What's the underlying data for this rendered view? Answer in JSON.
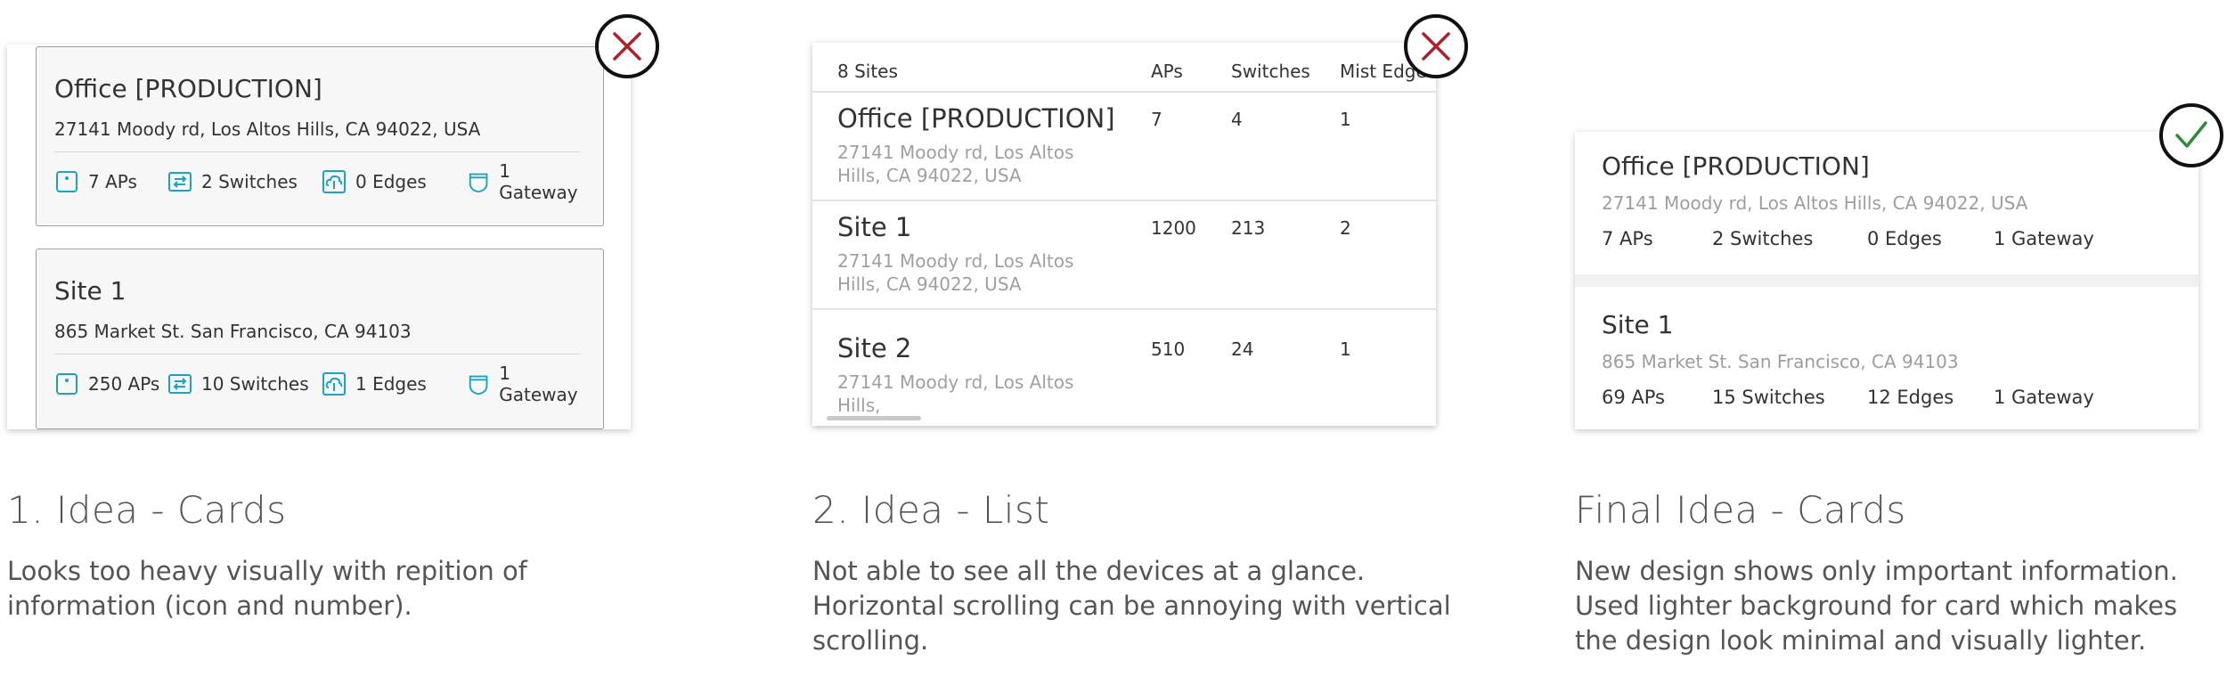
{
  "idea1": {
    "cards": [
      {
        "title": "Office [PRODUCTION]",
        "address": "27141 Moody rd, Los Altos Hills, CA 94022, USA",
        "aps": "7 APs",
        "switches": "2 Switches",
        "edges": "0 Edges",
        "gateways": "1 Gateway"
      },
      {
        "title": "Site 1",
        "address": "865 Market St. San Francisco, CA 94103",
        "aps": "250 APs",
        "switches": "10 Switches",
        "edges": "1 Edges",
        "gateways": "1 Gateway"
      }
    ],
    "heading": "1. Idea - Cards",
    "description": "Looks too heavy visually with repition of information (icon and number)."
  },
  "idea2": {
    "header": {
      "count": "8 Sites",
      "aps": "APs",
      "switches": "Switches",
      "edges": "Mist Edges"
    },
    "rows": [
      {
        "title": "Office [PRODUCTION]",
        "address": "27141 Moody rd, Los Altos Hills, CA 94022, USA",
        "aps": "7",
        "switches": "4",
        "edges": "1"
      },
      {
        "title": "Site 1",
        "address": "27141 Moody rd, Los Altos Hills, CA 94022, USA",
        "aps": "1200",
        "switches": "213",
        "edges": "2"
      },
      {
        "title": "Site 2",
        "address": "27141 Moody rd, Los Altos Hills,",
        "aps": "510",
        "switches": "24",
        "edges": "1"
      }
    ],
    "heading": "2. Idea - List",
    "description": "Not able to see all the devices at a glance. Horizontal scrolling can be annoying with vertical scrolling."
  },
  "final": {
    "cards": [
      {
        "title": "Office [PRODUCTION]",
        "address": "27141 Moody rd, Los Altos Hills, CA 94022, USA",
        "aps": "7 APs",
        "switches": "2 Switches",
        "edges": "0 Edges",
        "gateways": "1 Gateway"
      },
      {
        "title": "Site 1",
        "address": "865 Market St. San Francisco, CA 94103",
        "aps": "69 APs",
        "switches": "15 Switches",
        "edges": "12 Edges",
        "gateways": "1 Gateway"
      }
    ],
    "heading": "Final Idea - Cards",
    "description": "New design shows only important information. Used lighter background for card which makes the design look minimal and visually lighter."
  },
  "icons": {
    "reject": "close-x-icon",
    "approve": "checkmark-icon",
    "ap": "access-point-icon",
    "switch": "switch-arrows-icon",
    "edge": "cloud-edge-icon",
    "gateway": "gateway-shield-icon"
  },
  "colors": {
    "reject": "#b0202a",
    "approve": "#2e8b3a",
    "icon_accent": "#1aa3c4",
    "card_bg": "#f7f7f7",
    "muted_text": "#a0a0a0"
  }
}
